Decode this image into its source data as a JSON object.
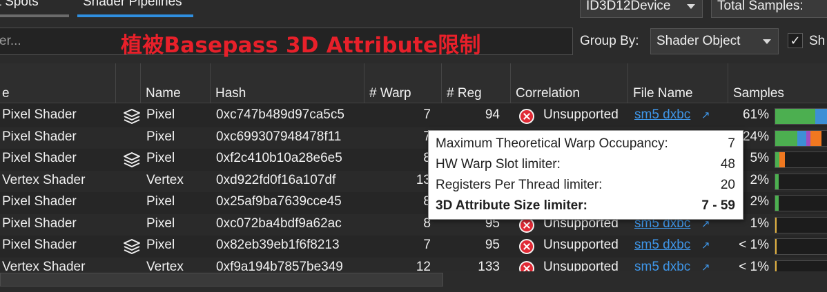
{
  "tabs": [
    {
      "label": "Hot Spots",
      "visible": "ot Spots"
    },
    {
      "label": "Shader Pipelines",
      "active": true
    }
  ],
  "device_combo": {
    "value": "ID3D12Device"
  },
  "samples_combo": {
    "value": "Total Samples:"
  },
  "filter": {
    "placeholder_visible": "er..."
  },
  "overlay_title": "植被Basepass 3D Attribute限制",
  "group_by": {
    "label": "Group By:",
    "value": "Shader Object"
  },
  "checkbox": {
    "checked": true,
    "label_visible": "Sh"
  },
  "columns": {
    "type": "e",
    "name": "Name",
    "hash": "Hash",
    "warp": "# Warp",
    "reg": "# Reg",
    "correlation": "Correlation",
    "file": "File Name",
    "samples": "Samples"
  },
  "rows": [
    {
      "type": "Pixel Shader",
      "icon": true,
      "name": "Pixel",
      "hash": "0xc747b489d97ca5c5",
      "warp": "7",
      "reg": "94",
      "corr": "Unsupported",
      "file": "sm5 dxbc",
      "samples": "61%",
      "bar": [
        {
          "frac": 0.36,
          "color": "#4caf50"
        },
        {
          "frac": 0.2,
          "color": "#3d8fd6"
        }
      ]
    },
    {
      "type": "Pixel Shader",
      "icon": false,
      "name": "Pixel",
      "hash": "0xc699307948478f11",
      "warp": "7",
      "reg": "",
      "corr": "",
      "file": "",
      "samples": "24%",
      "bar": [
        {
          "frac": 0.2,
          "color": "#4caf50"
        },
        {
          "frac": 0.08,
          "color": "#3d8fd6"
        },
        {
          "frac": 0.04,
          "color": "#a04cc0"
        },
        {
          "frac": 0.1,
          "color": "#f07820"
        }
      ]
    },
    {
      "type": "Pixel Shader",
      "icon": true,
      "name": "Pixel",
      "hash": "0xf2c410b10a28e6e5",
      "warp": "8",
      "reg": "",
      "corr": "",
      "file": "",
      "samples": "5%",
      "bar": [
        {
          "frac": 0.04,
          "color": "#4caf50"
        },
        {
          "frac": 0.05,
          "color": "#f07820"
        }
      ]
    },
    {
      "type": "Vertex Shader",
      "icon": false,
      "name": "Vertex",
      "hash": "0xd922fd0f16a107df",
      "warp": "13",
      "reg": "",
      "corr": "",
      "file": "",
      "samples": "2%",
      "bar": [
        {
          "frac": 0.03,
          "color": "#4caf50"
        }
      ]
    },
    {
      "type": "Pixel Shader",
      "icon": false,
      "name": "Pixel",
      "hash": "0x25af9ba7639cce45",
      "warp": "8",
      "reg": "",
      "corr": "",
      "file": "",
      "samples": "2%",
      "bar": [
        {
          "frac": 0.03,
          "color": "#4caf50"
        }
      ]
    },
    {
      "type": "Pixel Shader",
      "icon": false,
      "name": "Pixel",
      "hash": "0xc072ba4bdf9a62ac",
      "warp": "8",
      "reg": "95",
      "corr": "Unsupported",
      "file": "sm5 dxbc",
      "samples": "1%",
      "bar": [
        {
          "frac": 0.015,
          "color": "#e0b040"
        }
      ]
    },
    {
      "type": "Pixel Shader",
      "icon": true,
      "name": "Pixel",
      "hash": "0x82eb39eb1f6f8213",
      "warp": "7",
      "reg": "95",
      "corr": "Unsupported",
      "file": "sm5 dxbc",
      "samples": "< 1%",
      "bar": [
        {
          "frac": 0.015,
          "color": "#e0b040"
        }
      ]
    },
    {
      "type": "Vertex Shader",
      "icon": false,
      "name": "Vertex",
      "hash": "0xf9a194b7857be349",
      "warp": "12",
      "reg": "133",
      "corr": "Unsupported",
      "file": "sm5 dxbc",
      "samples": "< 1%",
      "bar": [
        {
          "frac": 0.015,
          "color": "#e0b040"
        }
      ]
    }
  ],
  "tooltip": [
    {
      "label": "Maximum Theoretical Warp Occupancy:",
      "value": "7",
      "bold": false
    },
    {
      "label": "HW Warp Slot limiter:",
      "value": "48",
      "bold": false
    },
    {
      "label": "Registers Per Thread limiter:",
      "value": "20",
      "bold": false
    },
    {
      "label": "3D Attribute Size limiter:",
      "value": "7 - 59",
      "bold": true
    }
  ],
  "colors": {
    "accent_tab": "#2f8fe0",
    "link": "#3f97ea",
    "error": "#e02a35",
    "overlay_text": "#e8202a"
  }
}
